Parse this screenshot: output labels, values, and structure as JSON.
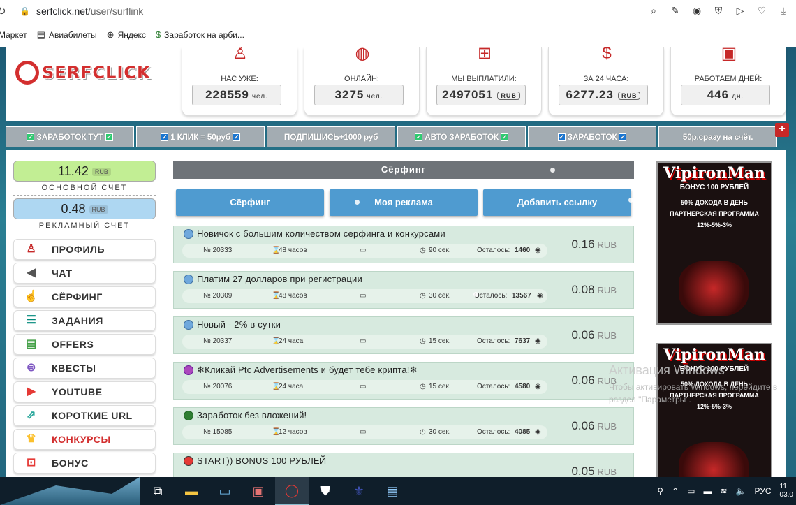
{
  "browser": {
    "url_host": "serfclick.net",
    "url_path": "/user/surflink",
    "bookmarks": [
      "Маркет",
      "Авиабилеты",
      "Яндекс",
      "Заработок на арби..."
    ]
  },
  "stats": [
    {
      "label": "НАС УЖЕ:",
      "value": "228559",
      "unit": "чел."
    },
    {
      "label": "ОНЛАЙН:",
      "value": "3275",
      "unit": "чел."
    },
    {
      "label": "МЫ ВЫПЛАТИЛИ:",
      "value": "2497051",
      "unit": "RUB"
    },
    {
      "label": "ЗА 24 ЧАСА:",
      "value": "6277.23",
      "unit": "RUB"
    },
    {
      "label": "РАБОТАЕМ ДНЕЙ:",
      "value": "446",
      "unit": "дн."
    }
  ],
  "promo": [
    {
      "text": "ЗАРАБОТОК ТУТ"
    },
    {
      "text": "1 КЛИК = 50руб"
    },
    {
      "text": "ПОДПИШИСЬ+1000 руб"
    },
    {
      "text": "АВТО ЗАРАБОТОК"
    },
    {
      "text": "ЗАРАБОТОК"
    },
    {
      "text": "50р.сразу на счёт."
    }
  ],
  "balance": {
    "main_value": "11.42",
    "main_unit": "RUB",
    "main_label": "ОСНОВНОЙ СЧЕТ",
    "ad_value": "0.48",
    "ad_unit": "RUB",
    "ad_label": "РЕКЛАМНЫЙ СЧЕТ"
  },
  "menu": [
    "ПРОФИЛЬ",
    "ЧАТ",
    "СЁРФИНГ",
    "ЗАДАНИЯ",
    "OFFERS",
    "КВЕСТЫ",
    "YOUTUBE",
    "КОРОТКИЕ URL",
    "КОНКУРСЫ",
    "БОНУС"
  ],
  "section_title": "Сёрфинг",
  "tabs": [
    "Сёрфинг",
    "Моя реклама",
    "Добавить ссылку"
  ],
  "links": [
    {
      "title": "Новичок с большим количеством серфинга и конкурсами",
      "id": "№ 20333",
      "period": "48 часов",
      "time": "90 сек.",
      "left_label": "Осталось:",
      "left": "1460",
      "price": "0.16",
      "unit": "RUB"
    },
    {
      "title": "Платим 27 долларов при регистрации",
      "id": "№ 20309",
      "period": "48 часов",
      "time": "30 сек.",
      "left_label": "Осталось:",
      "left": "13567",
      "price": "0.08",
      "unit": "RUB"
    },
    {
      "title": "Новый - 2% в сутки",
      "id": "№ 20337",
      "period": "24 часа",
      "time": "15 сек.",
      "left_label": "Осталось:",
      "left": "7637",
      "price": "0.06",
      "unit": "RUB"
    },
    {
      "title": "❄Кликай Ptc Advertisements и будет тебе крипта!❄",
      "id": "№ 20076",
      "period": "24 часа",
      "time": "15 сек.",
      "left_label": "Осталось:",
      "left": "4580",
      "price": "0.06",
      "unit": "RUB"
    },
    {
      "title": "Заработок без вложений!",
      "id": "№ 15085",
      "period": "12 часов",
      "time": "30 сек.",
      "left_label": "Осталось:",
      "left": "4085",
      "price": "0.06",
      "unit": "RUB"
    },
    {
      "title": "START)) BONUS 100 РУБЛЕЙ",
      "id": "",
      "period": "",
      "time": "",
      "left_label": "",
      "left": "",
      "price": "0.05",
      "unit": "RUB"
    }
  ],
  "ads": [
    {
      "title": "VipironMan",
      "sub": "БОНУС 100 РУБЛЕЙ",
      "l1": "50% ДОХОДА В ДЕНЬ",
      "l2": "ПАРТНЕРСКАЯ ПРОГРАММА",
      "l3": "12%-5%-3%"
    },
    {
      "title": "VipironMan",
      "sub": "БОНУС 100 РУБЛЕЙ",
      "l1": "50% ДОХОДА В ДЕНЬ",
      "l2": "ПАРТНЕРСКАЯ ПРОГРАММА",
      "l3": "12%-5%-3%"
    }
  ],
  "watermark": {
    "line1": "Активация Windows",
    "line2": "Чтобы активировать Windows, перейдите в",
    "line3": "раздел \"Параметры\"."
  },
  "taskbar": {
    "lang": "РУС",
    "time": "11",
    "date": "03.0"
  }
}
